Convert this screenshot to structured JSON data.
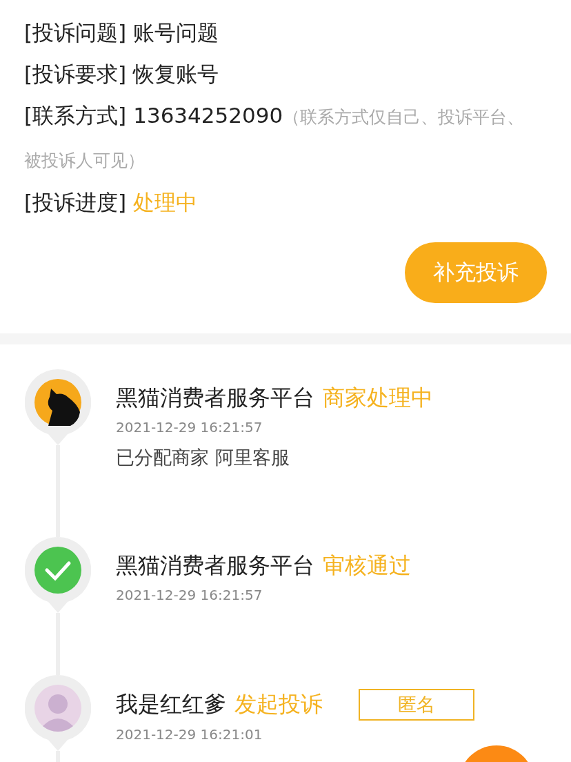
{
  "details": [
    {
      "label": "[投诉问题]",
      "value": "账号问题",
      "kind": "plain"
    },
    {
      "label": "[投诉要求]",
      "value": "恢复账号",
      "kind": "plain"
    },
    {
      "label": "[联系方式]",
      "value": "13634252090",
      "note": "（联系方式仅自己、投诉平台、被投诉人可见）",
      "kind": "contact"
    },
    {
      "label": "[投诉进度]",
      "value": "处理中",
      "kind": "status"
    }
  ],
  "supplement_button": "补充投诉",
  "timeline": [
    {
      "kind": "cat",
      "name": "黑猫消费者服务平台",
      "status": "商家处理中",
      "time": "2021-12-29 16:21:57",
      "message": "已分配商家 阿里客服"
    },
    {
      "kind": "check",
      "name": "黑猫消费者服务平台",
      "status": "审核通过",
      "time": "2021-12-29 16:21:57"
    },
    {
      "kind": "person",
      "name": "我是红红爹",
      "status": "发起投诉",
      "badge": "匿名",
      "time": "2021-12-29 16:21:01"
    }
  ]
}
